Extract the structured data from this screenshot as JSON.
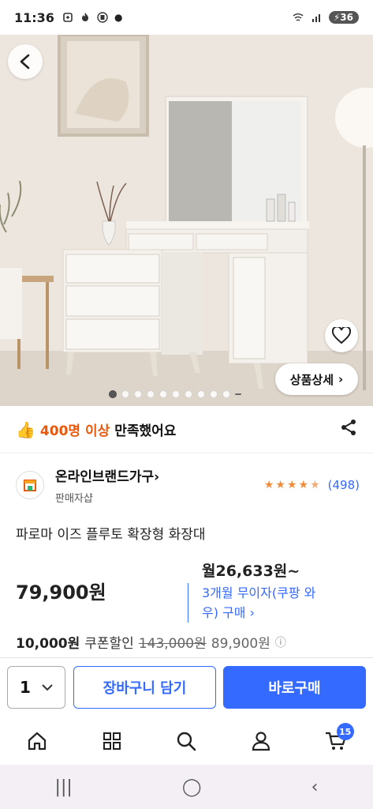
{
  "status_bar": {
    "time": "11:36",
    "battery": "36"
  },
  "hero": {
    "detail_label": "상품상세",
    "slides_total": 11,
    "slide_active": 1
  },
  "satisfaction": {
    "highlight": "400명 이상",
    "text": "만족했어요"
  },
  "seller": {
    "name": "온라인브랜드가구",
    "sub": "판매자샵",
    "rating_count": "(498)",
    "rating_stars": 4.5
  },
  "product": {
    "title": "파로마 이즈 플루토 확장형 화장대"
  },
  "price": {
    "main": "79,900원",
    "monthly": "월26,633원~",
    "installment_line1": "3개월 무이자(쿠팡 와",
    "installment_line2": "우) 구매 ›",
    "coupon_amount": "10,000원",
    "coupon_label": "쿠폰할인",
    "original": "143,000원",
    "final": "89,900원"
  },
  "actions": {
    "quantity": "1",
    "cart_label": "장바구니 담기",
    "buy_label": "바로구매"
  },
  "bottom_nav": {
    "cart_badge": "15"
  },
  "colors": {
    "accent": "#346aff",
    "highlight": "#e8590c",
    "star": "#f08c3c"
  }
}
